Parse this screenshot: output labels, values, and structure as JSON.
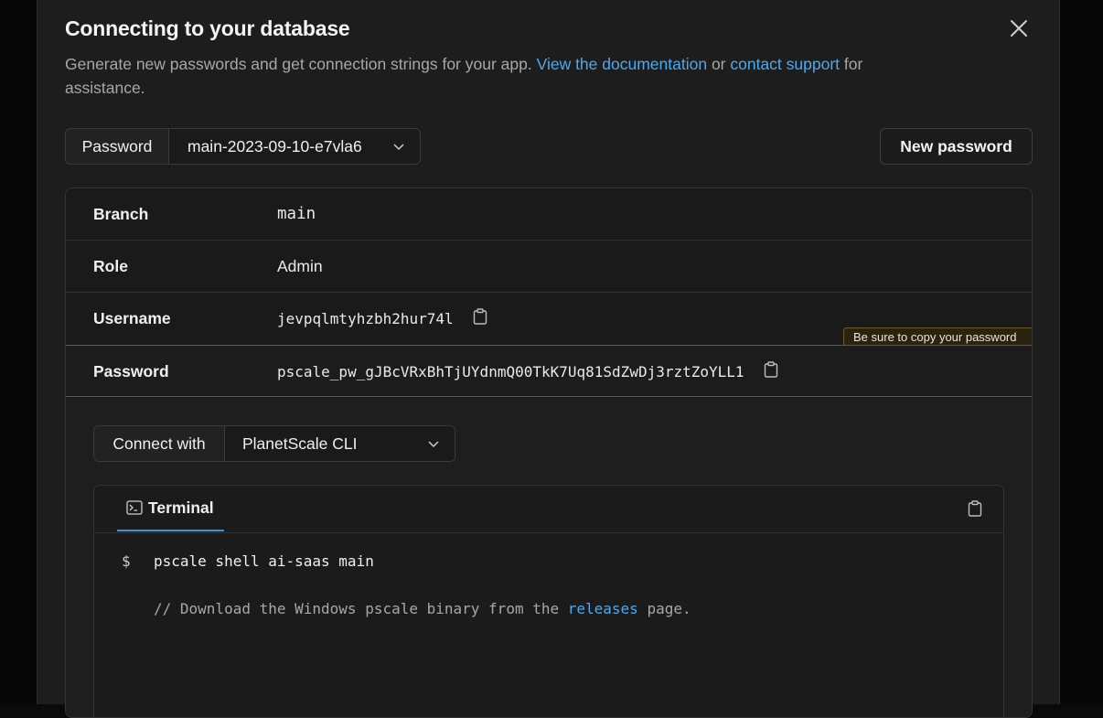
{
  "modal": {
    "title": "Connecting to your database",
    "subtitle_prefix": "Generate new passwords and get connection strings for your app.",
    "doc_link": "View the documentation",
    "or_text": "or",
    "support_link": "contact support",
    "subtitle_suffix": "for assistance."
  },
  "password_select": {
    "label": "Password",
    "value": "main-2023-09-10-e7vla6"
  },
  "new_password_button": "New password",
  "details": {
    "branch": {
      "label": "Branch",
      "value": "main"
    },
    "role": {
      "label": "Role",
      "value": "Admin"
    },
    "username": {
      "label": "Username",
      "value": "jevpqlmtyhzbh2hur74l"
    },
    "password": {
      "label": "Password",
      "value": "pscale_pw_gJBcVRxBhTjUYdnmQ00TkK7Uq81SdZwDj3rztZoYLL1"
    },
    "copy_hint": "Be sure to copy your password"
  },
  "connect": {
    "label": "Connect with",
    "value": "PlanetScale CLI"
  },
  "terminal": {
    "tab_label": "Terminal",
    "prompt": "$",
    "command": "pscale shell ai-saas main",
    "comment_prefix": "// Download the Windows pscale binary from the",
    "comment_link": "releases",
    "comment_suffix": "page."
  },
  "colors": {
    "accent_link": "#4aaaf0",
    "branch_purple": "#b48cf0",
    "warning_border": "#6e5a1d"
  },
  "icons": [
    "close-icon",
    "chevron-down-icon",
    "clipboard-icon",
    "terminal-icon"
  ]
}
